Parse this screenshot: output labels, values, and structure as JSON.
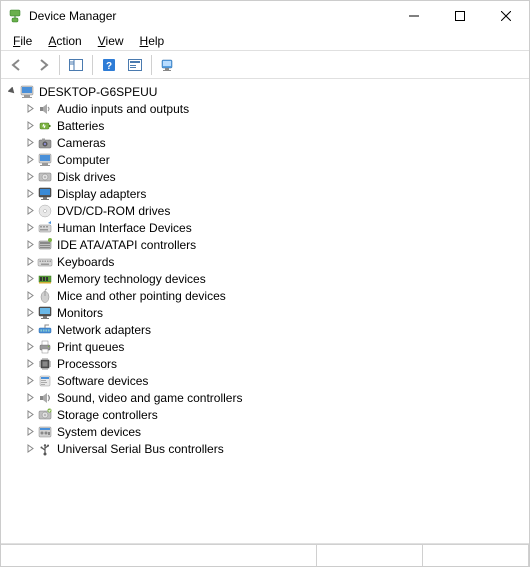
{
  "window": {
    "title": "Device Manager"
  },
  "menu": {
    "file": "File",
    "action": "Action",
    "view": "View",
    "help": "Help"
  },
  "tree": {
    "root": "DESKTOP-G6SPEUU",
    "categories": [
      {
        "label": "Audio inputs and outputs",
        "icon": "speaker"
      },
      {
        "label": "Batteries",
        "icon": "battery"
      },
      {
        "label": "Cameras",
        "icon": "camera"
      },
      {
        "label": "Computer",
        "icon": "computer"
      },
      {
        "label": "Disk drives",
        "icon": "disk"
      },
      {
        "label": "Display adapters",
        "icon": "display"
      },
      {
        "label": "DVD/CD-ROM drives",
        "icon": "dvd"
      },
      {
        "label": "Human Interface Devices",
        "icon": "hid"
      },
      {
        "label": "IDE ATA/ATAPI controllers",
        "icon": "ide"
      },
      {
        "label": "Keyboards",
        "icon": "keyboard"
      },
      {
        "label": "Memory technology devices",
        "icon": "memory"
      },
      {
        "label": "Mice and other pointing devices",
        "icon": "mouse"
      },
      {
        "label": "Monitors",
        "icon": "monitor"
      },
      {
        "label": "Network adapters",
        "icon": "network"
      },
      {
        "label": "Print queues",
        "icon": "printer"
      },
      {
        "label": "Processors",
        "icon": "cpu"
      },
      {
        "label": "Software devices",
        "icon": "software"
      },
      {
        "label": "Sound, video and game controllers",
        "icon": "sound"
      },
      {
        "label": "Storage controllers",
        "icon": "storage"
      },
      {
        "label": "System devices",
        "icon": "system"
      },
      {
        "label": "Universal Serial Bus controllers",
        "icon": "usb"
      }
    ]
  }
}
